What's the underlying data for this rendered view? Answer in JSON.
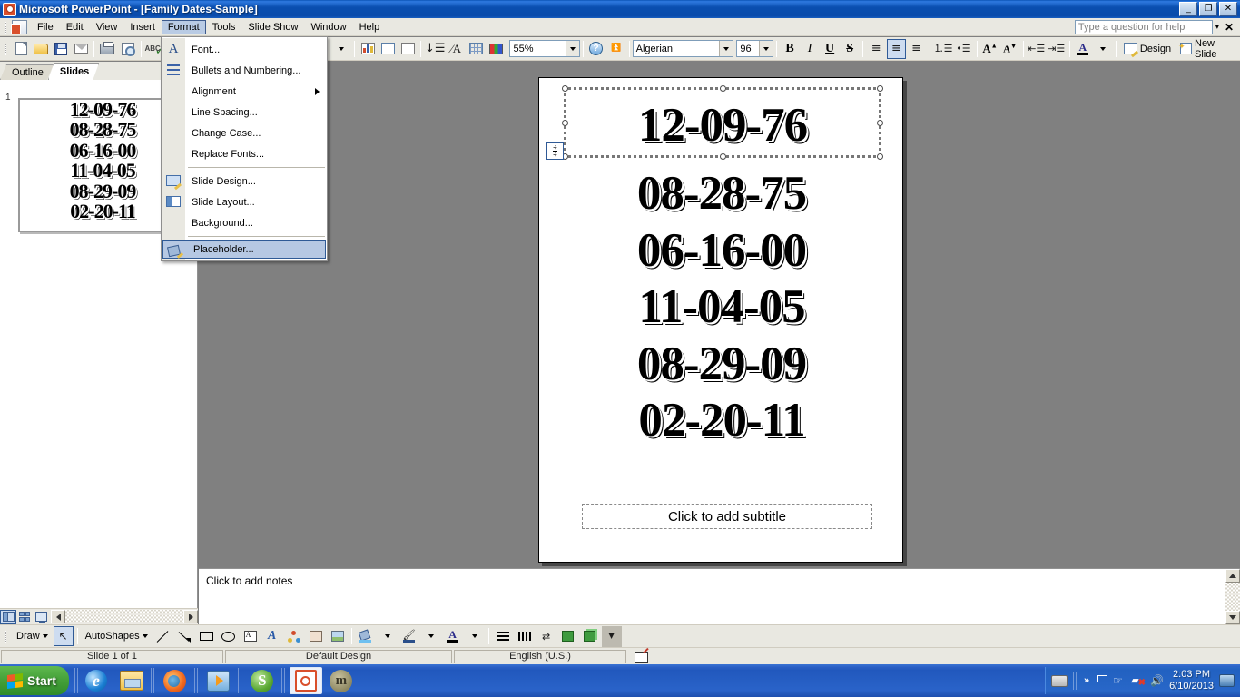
{
  "window": {
    "app_icon": "powerpoint-icon",
    "title": "Microsoft PowerPoint - [Family Dates-Sample]",
    "minimize_label": "_",
    "restore_label": "❐",
    "close_label": "✕"
  },
  "menubar": {
    "items": [
      {
        "label": "File",
        "mnemonic": "F"
      },
      {
        "label": "Edit",
        "mnemonic": "E"
      },
      {
        "label": "View",
        "mnemonic": "V"
      },
      {
        "label": "Insert",
        "mnemonic": "I"
      },
      {
        "label": "Format",
        "mnemonic": "o",
        "active": true
      },
      {
        "label": "Tools",
        "mnemonic": "T"
      },
      {
        "label": "Slide Show",
        "mnemonic": "S"
      },
      {
        "label": "Window",
        "mnemonic": "W"
      },
      {
        "label": "Help",
        "mnemonic": "H"
      }
    ],
    "help_box": {
      "placeholder": "Type a question for help",
      "value": "",
      "close_label": "✕"
    }
  },
  "format_menu": {
    "items": [
      {
        "label": "Font...",
        "icon": "font-A-icon",
        "selected": false
      },
      {
        "label": "Bullets and Numbering...",
        "icon": "bullets-icon",
        "selected": false
      },
      {
        "label": "Alignment",
        "icon": "none",
        "submenu": true,
        "selected": false
      },
      {
        "label": "Line Spacing...",
        "icon": "none",
        "selected": false
      },
      {
        "label": "Change Case...",
        "icon": "none",
        "selected": false
      },
      {
        "label": "Replace Fonts...",
        "icon": "none",
        "selected": false
      },
      {
        "label": "Slide Design...",
        "icon": "slide-design-icon",
        "selected": false
      },
      {
        "label": "Slide Layout...",
        "icon": "slide-layout-icon",
        "selected": false
      },
      {
        "label": "Background...",
        "icon": "none",
        "selected": false
      },
      {
        "label": "Placeholder...",
        "icon": "placeholder-icon",
        "selected": true
      }
    ]
  },
  "standard_toolbar": {
    "buttons": [
      {
        "name": "new-button",
        "icon": "new-document-icon"
      },
      {
        "name": "open-button",
        "icon": "open-folder-icon"
      },
      {
        "name": "save-button",
        "icon": "save-disk-icon"
      },
      {
        "name": "email-button",
        "icon": "email-icon"
      },
      {
        "name": "print-button",
        "icon": "printer-icon"
      },
      {
        "name": "print-preview-button",
        "icon": "print-preview-icon"
      },
      {
        "name": "spelling-button",
        "icon": "spelling-abc-icon"
      },
      {
        "name": "insert-chart-button",
        "icon": "chart-icon"
      },
      {
        "name": "insert-table-button",
        "icon": "table-icon"
      },
      {
        "name": "new-slide-table-button",
        "icon": "table-edit-icon"
      },
      {
        "name": "insert-text-button",
        "icon": "insert-text-icon"
      },
      {
        "name": "expand-all-button",
        "icon": "expand-all-icon"
      },
      {
        "name": "show-formatting-button",
        "icon": "grid-icon"
      },
      {
        "name": "show-color-button",
        "icon": "color-grayscale-icon"
      }
    ],
    "zoom": {
      "value": "55%",
      "name": "zoom-combo"
    },
    "help_button_icon": "help-question-icon"
  },
  "formatting_toolbar": {
    "font": {
      "value": "Algerian",
      "name": "font-name-combo"
    },
    "size": {
      "value": "96",
      "name": "font-size-combo"
    },
    "bold_label": "B",
    "italic_label": "I",
    "underline_label": "U",
    "shadow_label": "S",
    "align_left": "align-left-icon",
    "align_center": "align-center-icon",
    "align_right": "align-right-icon",
    "numbering": "numbering-icon",
    "bullets": "bullets-icon",
    "increase_font": "increase-font-icon",
    "decrease_font": "decrease-font-icon",
    "decrease_indent": "decrease-indent-icon",
    "increase_indent": "increase-indent-icon",
    "font_color": "font-color-icon",
    "design_label": "Design",
    "new_slide_label": "New Slide"
  },
  "left_pane": {
    "tabs": [
      {
        "label": "Outline",
        "active": false
      },
      {
        "label": "Slides",
        "active": true
      }
    ],
    "slide_number": "1",
    "thumbnail_lines": [
      "12-09-76",
      "08-28-75",
      "06-16-00",
      "11-04-05",
      "08-29-09",
      "02-20-11"
    ]
  },
  "slide": {
    "title_text": "12-09-76",
    "body_lines": [
      "08-28-75",
      "06-16-00",
      "11-04-05",
      "08-29-09",
      "02-20-11"
    ],
    "subtitle_placeholder": "Click to add subtitle",
    "autofit_icon": "autofit-options-icon"
  },
  "notes": {
    "placeholder": "Click to add notes"
  },
  "view_buttons": [
    {
      "name": "normal-view-button",
      "icon": "normal-view-icon",
      "active": true
    },
    {
      "name": "slide-sorter-button",
      "icon": "slide-sorter-icon",
      "active": false
    },
    {
      "name": "slide-show-button",
      "icon": "slide-show-icon",
      "active": false
    }
  ],
  "drawing_toolbar": {
    "draw_label": "Draw",
    "autoshapes_label": "AutoShapes",
    "buttons": [
      {
        "name": "select-objects-button",
        "icon": "arrow-pointer-icon"
      },
      {
        "name": "line-button",
        "icon": "line-icon"
      },
      {
        "name": "arrow-button",
        "icon": "arrow-icon"
      },
      {
        "name": "rectangle-button",
        "icon": "rectangle-icon"
      },
      {
        "name": "oval-button",
        "icon": "oval-icon"
      },
      {
        "name": "text-box-button",
        "icon": "text-box-icon"
      },
      {
        "name": "wordart-button",
        "icon": "wordart-icon"
      },
      {
        "name": "diagram-button",
        "icon": "diagram-icon"
      },
      {
        "name": "clip-art-button",
        "icon": "clip-art-icon"
      },
      {
        "name": "picture-button",
        "icon": "picture-icon"
      },
      {
        "name": "fill-color-button",
        "icon": "fill-color-icon"
      },
      {
        "name": "line-color-button",
        "icon": "line-color-icon"
      },
      {
        "name": "font-color-button",
        "icon": "font-color-icon"
      },
      {
        "name": "line-style-button",
        "icon": "line-style-icon"
      },
      {
        "name": "dash-style-button",
        "icon": "dash-style-icon"
      },
      {
        "name": "arrow-style-button",
        "icon": "arrow-style-icon"
      },
      {
        "name": "shadow-style-button",
        "icon": "shadow-style-icon"
      },
      {
        "name": "3d-style-button",
        "icon": "three-d-style-icon"
      }
    ]
  },
  "status_bar": {
    "slide_count": "Slide 1 of 1",
    "design": "Default Design",
    "language": "English (U.S.)",
    "spell_icon": "spell-check-icon"
  },
  "taskbar": {
    "start_label": "Start",
    "quick_launch": [
      {
        "name": "internet-explorer-icon",
        "glyph": "e"
      },
      {
        "name": "windows-explorer-icon",
        "glyph": ""
      }
    ],
    "tasks": [
      {
        "name": "firefox-icon",
        "active": false
      },
      {
        "name": "media-player-icon",
        "active": false
      },
      {
        "name": "skype-icon",
        "active": false,
        "glyph": "S"
      },
      {
        "name": "powerpoint-taskbar-icon",
        "active": true
      },
      {
        "name": "moodle-icon",
        "active": false,
        "glyph": "m"
      }
    ],
    "tray": {
      "keyboard_icon": "keyboard-icon",
      "chevron_icon": "show-hidden-icons-chevron",
      "flag_icon": "security-flag-icon",
      "hand_icon": "hand-share-icon",
      "network_icon": "network-disconnected-icon",
      "volume_icon": "volume-icon",
      "time": "2:03 PM",
      "date": "6/10/2013",
      "monitor_icon": "display-icon"
    }
  }
}
